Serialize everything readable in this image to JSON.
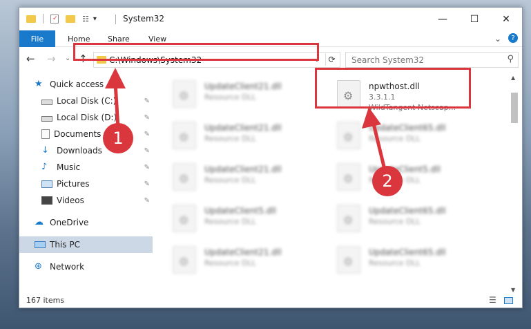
{
  "window": {
    "title": "System32",
    "minimize": "—",
    "maximize": "☐",
    "close": "✕"
  },
  "ribbon": {
    "file_tab": "File",
    "tabs": [
      "Home",
      "Share",
      "View"
    ],
    "help": "?",
    "expand": "⌄"
  },
  "nav": {
    "back": "←",
    "forward": "→",
    "recent": "⌄",
    "up": "↑",
    "address": "C:\\Windows\\System32",
    "address_dropdown": "⌄",
    "refresh": "⟳",
    "search_placeholder": "Search System32",
    "search_icon_glyph": "⚲"
  },
  "sidebar": {
    "items": [
      {
        "label": "Quick access",
        "icon": "star-icon",
        "pinned": false
      },
      {
        "label": "Local Disk (C:)",
        "icon": "drive-icon",
        "pinned": true
      },
      {
        "label": "Local Disk (D:)",
        "icon": "drive-icon",
        "pinned": true
      },
      {
        "label": "Documents",
        "icon": "documents-icon",
        "pinned": true
      },
      {
        "label": "Downloads",
        "icon": "downloads-icon",
        "pinned": true
      },
      {
        "label": "Music",
        "icon": "music-icon",
        "pinned": true
      },
      {
        "label": "Pictures",
        "icon": "pictures-icon",
        "pinned": true
      },
      {
        "label": "Videos",
        "icon": "videos-icon",
        "pinned": true
      },
      {
        "label": "OneDrive",
        "icon": "onedrive-icon",
        "pinned": false
      },
      {
        "label": "This PC",
        "icon": "this-pc-icon",
        "pinned": false
      },
      {
        "label": "Network",
        "icon": "network-icon",
        "pinned": false
      }
    ],
    "pin_glyph": "📌"
  },
  "files": [
    {
      "name": "UpdateClient21.dll",
      "desc": "Resource DLL",
      "blurred": true
    },
    {
      "name": "npwthost.dll",
      "version": "3.3.1.1",
      "desc": "WildTangent Netscap...",
      "blurred": false
    },
    {
      "name": "UpdateClient21.dll",
      "desc": "Resource DLL",
      "blurred": true
    },
    {
      "name": "UpdateClient65.dll",
      "desc": "Resource DLL",
      "blurred": true
    },
    {
      "name": "UpdateClient21.dll",
      "desc": "Resource DLL",
      "blurred": true
    },
    {
      "name": "UpdateClient5.dll",
      "desc": "Resource DLL",
      "blurred": true
    },
    {
      "name": "UpdateClient5.dll",
      "desc": "Resource DLL",
      "blurred": true
    },
    {
      "name": "UpdateClient65.dll",
      "desc": "Resource DLL",
      "blurred": true
    },
    {
      "name": "UpdateClient21.dll",
      "desc": "Resource DLL",
      "blurred": true
    },
    {
      "name": "UpdateClient65.dll",
      "desc": "Resource DLL",
      "blurred": true
    }
  ],
  "status": {
    "count": "167 items"
  },
  "annotations": {
    "step1": "1",
    "step2": "2",
    "color": "#d9363e"
  }
}
